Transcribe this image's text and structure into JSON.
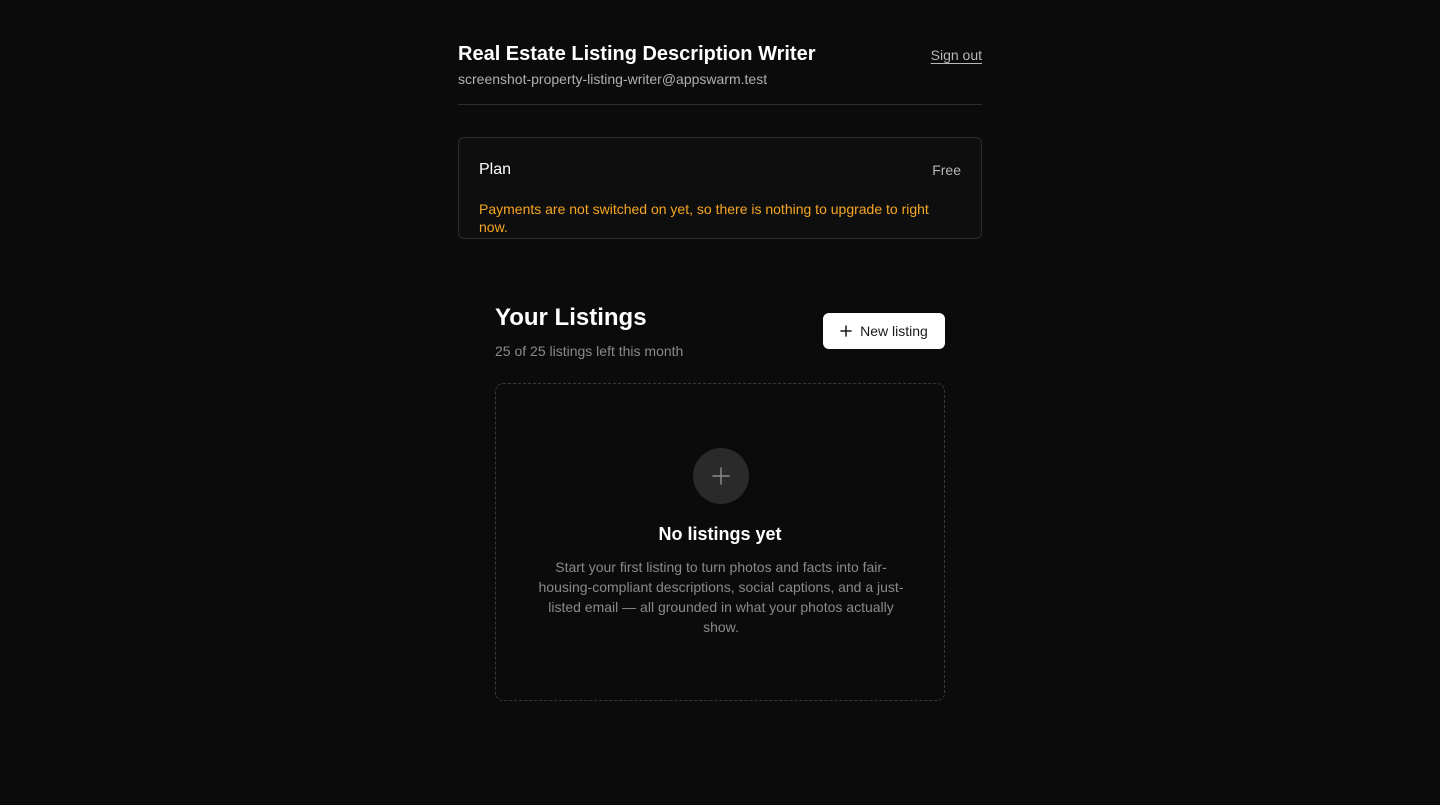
{
  "header": {
    "app_title": "Real Estate Listing Description Writer",
    "user_email": "screenshot-property-listing-writer@appswarm.test",
    "sign_out_label": "Sign out"
  },
  "plan": {
    "label": "Plan",
    "value": "Free",
    "notice": "Payments are not switched on yet, so there is nothing to upgrade to right now."
  },
  "listings": {
    "title": "Your Listings",
    "subtitle": "25 of 25 listings left this month",
    "new_listing_label": "New listing",
    "empty_title": "No listings yet",
    "empty_description": "Start your first listing to turn photos and facts into fair-housing-compliant descriptions, social captions, and a just-listed email — all grounded in what your photos actually show."
  },
  "colors": {
    "background": "#0b0b0b",
    "notice": "#f5a623",
    "button_bg": "#ffffff"
  },
  "icons": {
    "new_listing": "plus-icon",
    "empty_state": "plus-icon"
  }
}
